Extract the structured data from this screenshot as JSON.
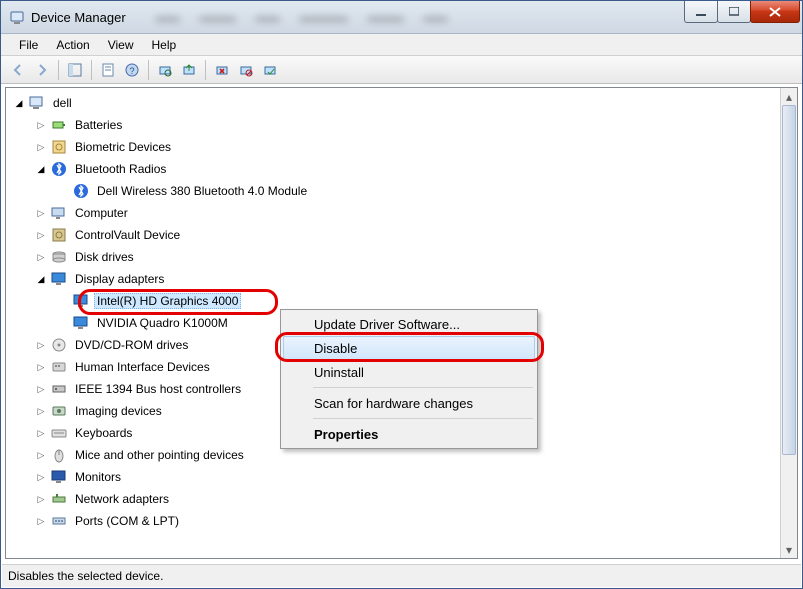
{
  "window": {
    "title": "Device Manager"
  },
  "menu": {
    "file": "File",
    "action": "Action",
    "view": "View",
    "help": "Help"
  },
  "tree": {
    "root": "dell",
    "items": [
      {
        "label": "Batteries",
        "icon": "battery"
      },
      {
        "label": "Biometric Devices",
        "icon": "biometric"
      },
      {
        "label": "Bluetooth Radios",
        "icon": "bluetooth",
        "expanded": true,
        "children": [
          {
            "label": "Dell Wireless 380 Bluetooth 4.0 Module",
            "icon": "bluetooth"
          }
        ]
      },
      {
        "label": "Computer",
        "icon": "computer"
      },
      {
        "label": "ControlVault Device",
        "icon": "vault"
      },
      {
        "label": "Disk drives",
        "icon": "disk"
      },
      {
        "label": "Display adapters",
        "icon": "display",
        "expanded": true,
        "children": [
          {
            "label": "Intel(R) HD Graphics 4000",
            "icon": "display",
            "selected": true
          },
          {
            "label": "NVIDIA Quadro K1000M",
            "icon": "display"
          }
        ]
      },
      {
        "label": "DVD/CD-ROM drives",
        "icon": "dvd"
      },
      {
        "label": "Human Interface Devices",
        "icon": "hid"
      },
      {
        "label": "IEEE 1394 Bus host controllers",
        "icon": "ieee"
      },
      {
        "label": "Imaging devices",
        "icon": "imaging"
      },
      {
        "label": "Keyboards",
        "icon": "keyboard"
      },
      {
        "label": "Mice and other pointing devices",
        "icon": "mouse"
      },
      {
        "label": "Monitors",
        "icon": "monitor"
      },
      {
        "label": "Network adapters",
        "icon": "network"
      },
      {
        "label": "Ports (COM & LPT)",
        "icon": "port"
      }
    ]
  },
  "context_menu": {
    "update": "Update Driver Software...",
    "disable": "Disable",
    "uninstall": "Uninstall",
    "scan": "Scan for hardware changes",
    "properties": "Properties"
  },
  "status": "Disables the selected device."
}
